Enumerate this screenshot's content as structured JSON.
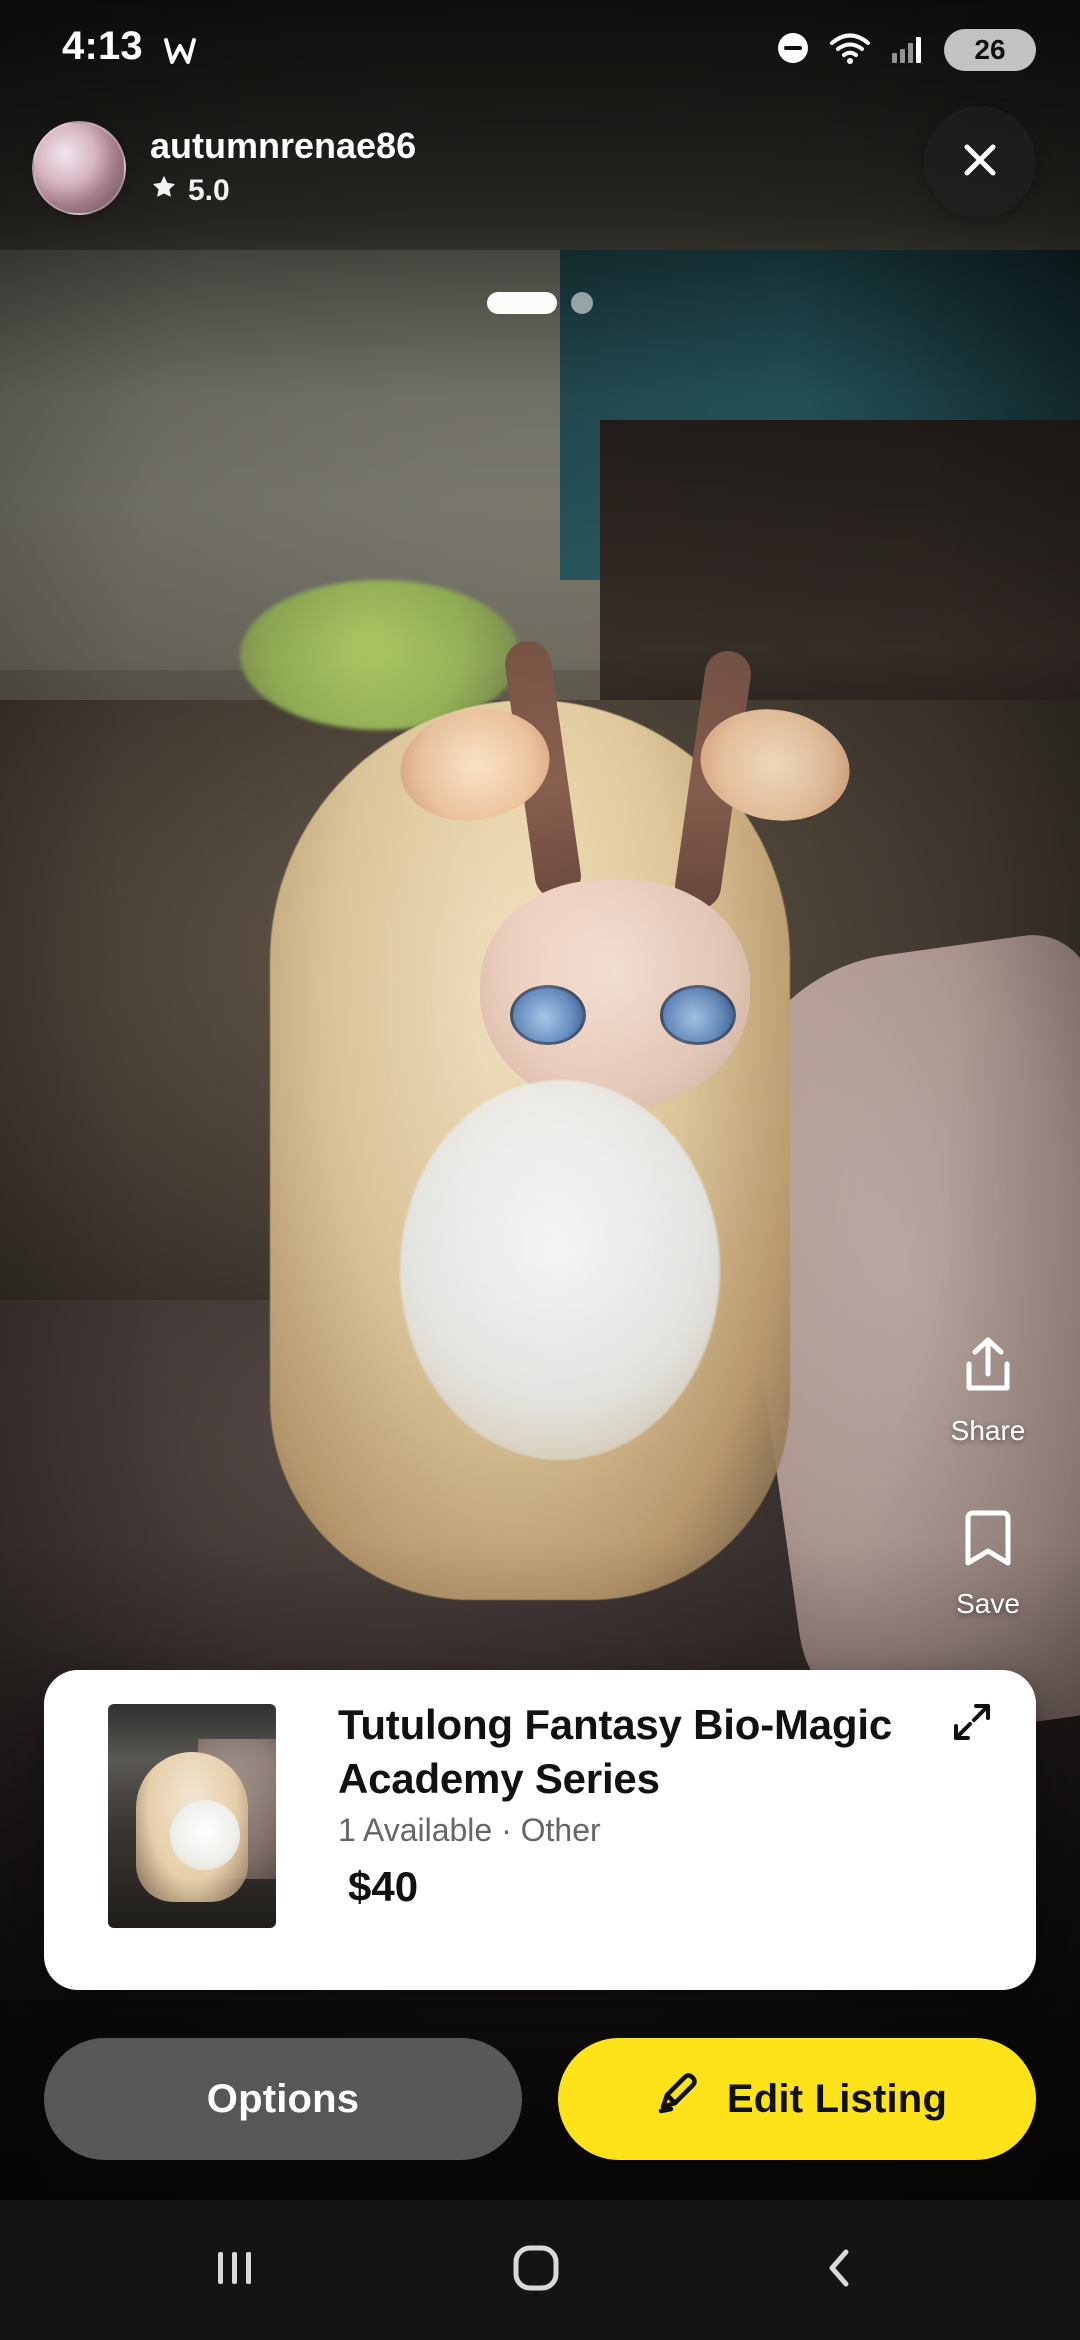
{
  "status_bar": {
    "time": "4:13",
    "battery": "26",
    "icons": [
      "w-app-icon",
      "dnd-icon",
      "wifi-icon",
      "cell-signal-icon",
      "battery-icon"
    ]
  },
  "seller": {
    "username": "autumnrenae86",
    "rating": "5.0"
  },
  "carousel": {
    "slide_count": 2,
    "active_index": 0
  },
  "side_actions": {
    "share_label": "Share",
    "save_label": "Save"
  },
  "listing": {
    "title": "Tutulong Fantasy Bio-Magic Academy Series",
    "availability": "1 Available · Other",
    "price": "$40"
  },
  "buttons": {
    "options_label": "Options",
    "edit_label": "Edit Listing"
  },
  "colors": {
    "accent_yellow": "#FFE31A",
    "card_bg": "#FFFFFF",
    "overlay_dark": "#141414"
  }
}
